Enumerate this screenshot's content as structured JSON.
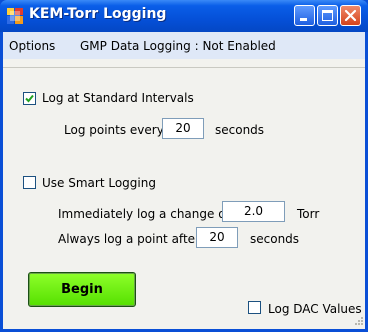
{
  "window": {
    "title": "KEM-Torr Logging",
    "icon": "app-logo-icon",
    "controls": [
      "minimize-icon",
      "maximize-icon",
      "close-icon"
    ]
  },
  "menu": {
    "options": "Options",
    "gmp_logging": "GMP Data Logging : Not Enabled"
  },
  "standard": {
    "checkbox_label": "Log at Standard Intervals",
    "checked": true,
    "points_label": "Log points every :",
    "points_value": "20",
    "points_unit": "seconds"
  },
  "smart": {
    "checkbox_label": "Use Smart Logging",
    "checked": false,
    "change_label": "Immediately log a change of :",
    "change_value": "2.0",
    "change_unit": "Torr",
    "always_label": "Always log a point after :",
    "always_value": "20",
    "always_unit": "seconds"
  },
  "actions": {
    "begin_label": "Begin"
  },
  "dac": {
    "checkbox_label": "Log DAC Values",
    "checked": false
  },
  "colors": {
    "title_bar": "#0550d8",
    "menu_bar": "#dfe8f7",
    "client_bg": "#f2f2ee",
    "begin_button": "#66ee10",
    "check_mark": "#21a121"
  }
}
